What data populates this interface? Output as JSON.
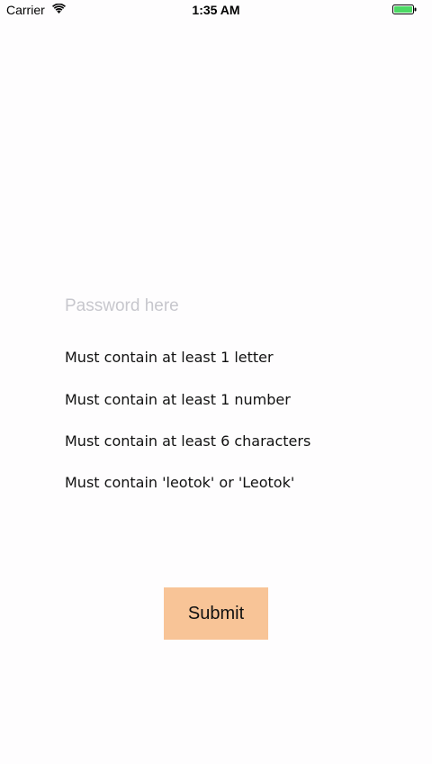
{
  "status_bar": {
    "carrier": "Carrier",
    "time": "1:35 AM",
    "wifi_icon": "wifi-icon",
    "battery_icon": "battery-icon",
    "battery_color": "#4cd964"
  },
  "form": {
    "password_placeholder": "Password here",
    "password_value": "",
    "rules": [
      "Must contain at least 1 letter",
      "Must contain at least 1 number",
      "Must contain at least 6 characters",
      "Must contain 'leotok' or 'Leotok'"
    ],
    "submit_label": "Submit",
    "submit_color": "#f8c497"
  }
}
